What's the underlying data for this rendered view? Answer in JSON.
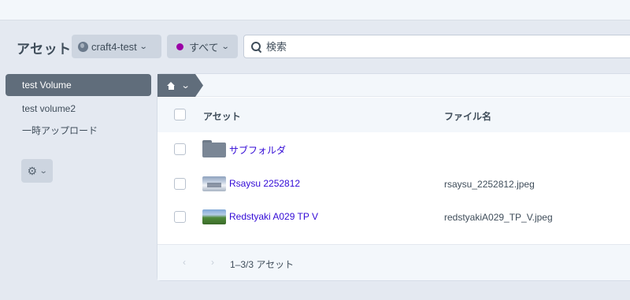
{
  "header": {
    "title": "アセット",
    "site_label": "craft4-test",
    "status_label": "すべて",
    "status_color": "#9b00a6",
    "search_placeholder": "検索"
  },
  "sidebar": {
    "items": [
      {
        "label": "test Volume",
        "selected": true
      },
      {
        "label": "test volume2",
        "selected": false
      },
      {
        "label": "一時アップロード",
        "selected": false
      }
    ],
    "settings_icon": "gear-icon"
  },
  "breadcrumb": {
    "icon": "home-icon"
  },
  "table": {
    "columns": [
      "アセット",
      "ファイル名"
    ],
    "rows": [
      {
        "type": "folder",
        "name": "サブフォルダ",
        "filename": ""
      },
      {
        "type": "image",
        "name": "Rsaysu 2252812",
        "filename": "rsaysu_2252812.jpeg"
      },
      {
        "type": "image",
        "name": "Redstyaki A029 TP V",
        "filename": "redstyakiA029_TP_V.jpeg"
      }
    ]
  },
  "footer": {
    "prev": "‹",
    "next": "›",
    "count": "1–3/3 アセット"
  },
  "colors": {
    "accent": "#606d7b",
    "link": "#3209d6",
    "background": "#e4e9f1"
  }
}
